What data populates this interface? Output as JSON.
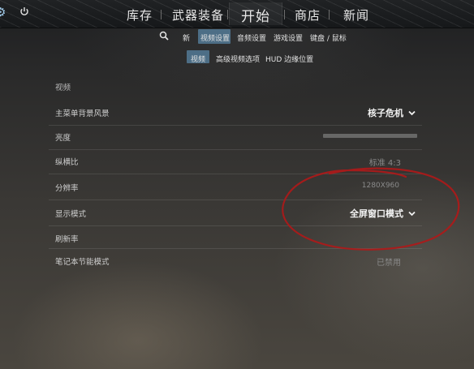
{
  "colors": {
    "accent": "#4d6e86",
    "annotation": "#b01818"
  },
  "topnav": {
    "gear_icon": "gear-icon",
    "power_icon": "power-icon",
    "items": [
      "库存",
      "武器装备",
      "开始",
      "商店",
      "新闻"
    ],
    "active": "开始"
  },
  "subnav": {
    "search_icon": "search-icon",
    "items": [
      "新",
      "视频设置",
      "音频设置",
      "游戏设置",
      "键盘 / 鼠标"
    ],
    "active": "视频设置"
  },
  "tabs": {
    "items": [
      "视频",
      "高级视频选项",
      "HUD 边缘位置"
    ],
    "active": "视频"
  },
  "settings": {
    "section_title": "视频",
    "rows": [
      {
        "label": "主菜单背景风景",
        "value": "核子危机",
        "type": "dropdown"
      },
      {
        "label": "亮度",
        "value": "",
        "type": "slider"
      },
      {
        "label": "纵横比",
        "value": "标准 4:3",
        "type": "dimmed"
      },
      {
        "label": "分辨率",
        "value": "1280X960",
        "type": "dimmed"
      },
      {
        "label": "显示模式",
        "value": "全屏窗口模式",
        "type": "dropdown"
      },
      {
        "label": "刷新率",
        "value": "",
        "type": "empty"
      },
      {
        "label": "笔记本节能模式",
        "value": "已禁用",
        "type": "dimmed"
      }
    ]
  }
}
